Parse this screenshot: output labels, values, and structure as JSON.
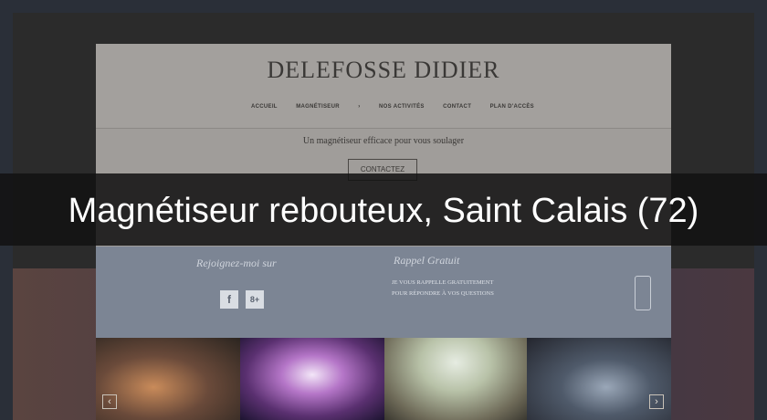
{
  "site": {
    "title": "DELEFOSSE DIDIER",
    "nav": [
      {
        "label": "ACCUEIL"
      },
      {
        "label": "MAGNÉTISEUR"
      },
      {
        "label": "›"
      },
      {
        "label": "NOS ACTIVITÉS"
      },
      {
        "label": "CONTACT"
      },
      {
        "label": "PLAN D'ACCÈS"
      }
    ],
    "tagline": "Un magnétiseur efficace pour vous soulager",
    "cta_label": "CONTACTEZ",
    "join_title": "Rejoignez-moi sur",
    "social": [
      {
        "glyph": "f",
        "icon": "facebook-icon"
      },
      {
        "glyph": "8+",
        "icon": "google-plus-icon"
      }
    ],
    "callback_title": "Rappel Gratuit",
    "callback_lines": [
      "JE VOUS RAPPELLE GRATUITEMENT",
      "POUR RÉPONDRE À VOS QUESTIONS"
    ],
    "slider": {
      "prev": "‹",
      "next": "›"
    }
  },
  "caption": "Magnétiseur rebouteux, Saint Calais (72)",
  "colors": {
    "page_bg": "#2a2f38",
    "site_bg": "#a09d9a",
    "blue_band": "#7c8594",
    "caption_bar": "#121212"
  }
}
